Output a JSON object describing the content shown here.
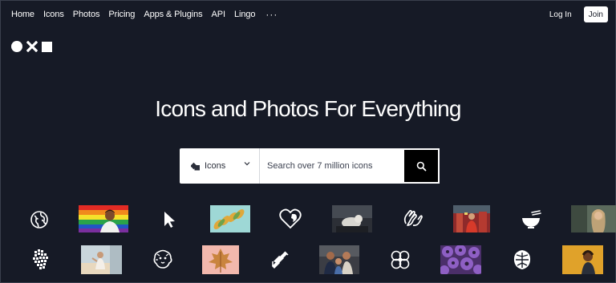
{
  "nav": {
    "links": [
      "Home",
      "Icons",
      "Photos",
      "Pricing",
      "Apps & Plugins",
      "API",
      "Lingo"
    ],
    "more": "···",
    "login": "Log In",
    "join": "Join"
  },
  "hero": {
    "title": "Icons and Photos For Everything"
  },
  "search": {
    "type_label": "Icons",
    "placeholder": "Search over 7 million icons"
  },
  "colors": {
    "background": "#161a26",
    "search_button": "#000000",
    "join_button_bg": "#ffffff"
  },
  "gallery": {
    "row1": [
      "globe-icon",
      "pride-photo",
      "cursor-icon",
      "leaves-photo",
      "heart-icon",
      "dog-photo",
      "hands-icon",
      "street-photo",
      "bowl-icon",
      "portrait-photo"
    ],
    "row2": [
      "hand-icon",
      "beach-photo",
      "lion-icon",
      "autumn-leaf-photo",
      "link-icon",
      "family-photo",
      "flower-icon",
      "purple-flowers-photo",
      "monstera-icon",
      "yellow-portrait-photo"
    ]
  }
}
